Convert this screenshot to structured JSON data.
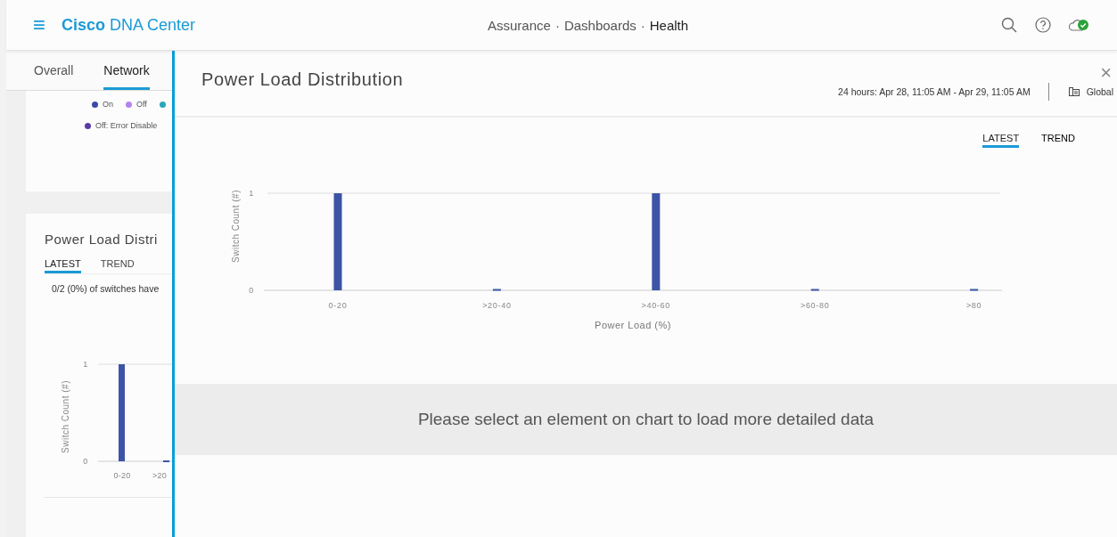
{
  "header": {
    "menu_icon": "≡",
    "brand_bold": "Cisco",
    "brand_rest": "DNA Center",
    "breadcrumb": [
      {
        "label": "Assurance",
        "current": false
      },
      {
        "label": "Dashboards",
        "current": false
      },
      {
        "label": "Health",
        "current": true
      }
    ],
    "separator": "·"
  },
  "page_tabs": [
    {
      "label": "Overall",
      "selected": false
    },
    {
      "label": "Network",
      "selected": true
    }
  ],
  "legend": [
    {
      "label": "On",
      "color": "#3b4aa8"
    },
    {
      "label": "Off",
      "color": "#b583ec"
    },
    {
      "color": "#2aa6b8"
    },
    {
      "label": "Off: Error Disable",
      "color": "#5b3aa6"
    }
  ],
  "card": {
    "title": "Power Load Distri",
    "tabs": [
      {
        "label": "LATEST",
        "selected": true
      },
      {
        "label": "TREND",
        "selected": false
      }
    ],
    "summary": "0/2 (0%) of switches have",
    "chart_data": {
      "type": "bar",
      "ylabel": "Switch Count (#)",
      "categories": [
        "0-20",
        ">20"
      ],
      "values": [
        1,
        0
      ],
      "yticks": [
        0,
        1
      ],
      "ylim": [
        0,
        1
      ]
    }
  },
  "drawer": {
    "title": "Power Load Distribution",
    "time_range": "24 hours: Apr 28, 11:05 AM - Apr 29, 11:05 AM",
    "site": "Global",
    "close": "×",
    "tabs": [
      {
        "label": "LATEST",
        "selected": true
      },
      {
        "label": "TREND",
        "selected": false
      }
    ],
    "chart_data": {
      "type": "bar",
      "xlabel": "Power Load (%)",
      "ylabel": "Switch Count (#)",
      "categories": [
        "0-20",
        ">20-40",
        ">40-60",
        ">60-80",
        ">80"
      ],
      "values": [
        1,
        0,
        1,
        0,
        0
      ],
      "yticks": [
        0,
        1
      ],
      "ylim": [
        0,
        1
      ]
    },
    "message": "Please select an element on chart to load more detailed data"
  }
}
